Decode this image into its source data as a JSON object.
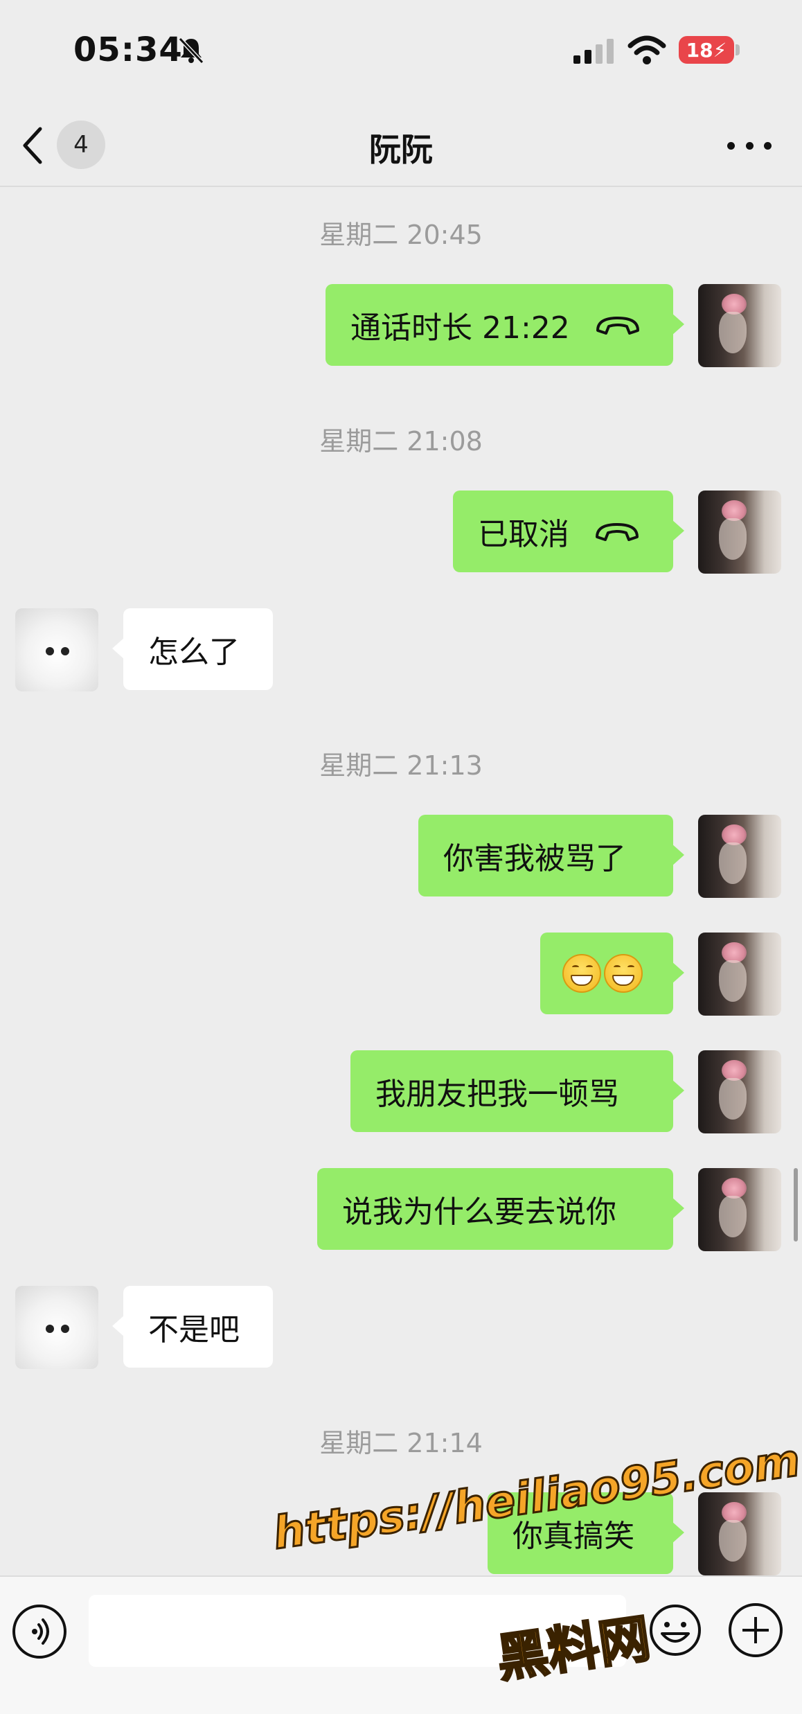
{
  "status_bar": {
    "time": "05:34",
    "battery": "18",
    "icons": [
      "bell-muted-icon",
      "signal-icon",
      "wifi-icon",
      "battery-icon"
    ]
  },
  "nav": {
    "unread_count": "4",
    "title": "阮阮",
    "back_icon": "chevron-left-icon",
    "more_icon": "more-dots-icon"
  },
  "messages": {
    "ts1": "星期二 20:45",
    "call1": "通话时长 21:22",
    "ts2": "星期二 21:08",
    "call2": "已取消",
    "in1": "怎么了",
    "ts3": "星期二 21:13",
    "out1": "你害我被骂了",
    "out2_emoji": [
      "grin-emoji",
      "grin-emoji"
    ],
    "out3": "我朋友把我一顿骂",
    "out4": "说我为什么要去说你",
    "in2": "不是吧",
    "ts4": "星期二 21:14",
    "out5": "你真搞笑"
  },
  "input_bar": {
    "value": "",
    "icons": [
      "voice-icon",
      "emoji-icon",
      "plus-icon"
    ]
  },
  "watermark": {
    "url": "https://heiliao95.com",
    "name": "黑料网"
  },
  "colors": {
    "background": "#ededed",
    "outgoing_bubble": "#95ec69",
    "incoming_bubble": "#ffffff",
    "timestamp": "#9b9b9b",
    "battery": "#e9454a",
    "watermark": "#f5a528"
  }
}
